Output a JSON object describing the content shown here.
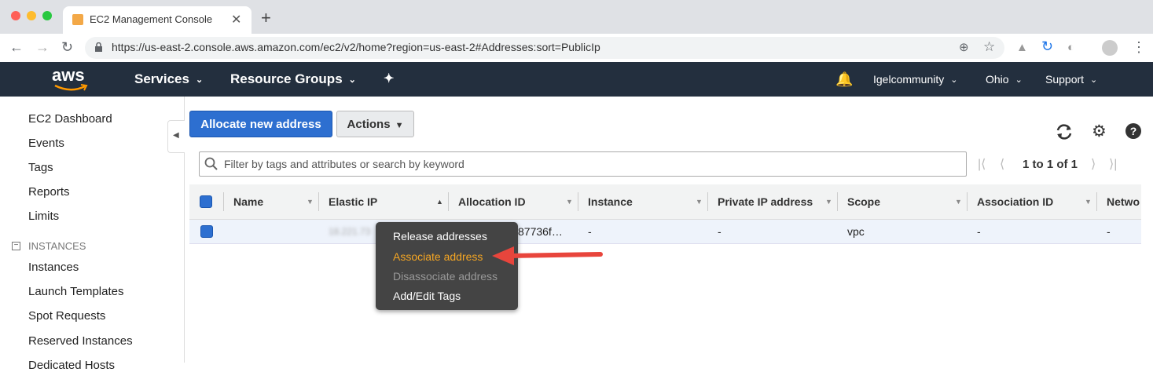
{
  "browser": {
    "tab_title": "EC2 Management Console",
    "new_tab_symbol": "+",
    "url": "https://us-east-2.console.aws.amazon.com/ec2/v2/home?region=us-east-2#Addresses:sort=PublicIp"
  },
  "aws_nav": {
    "logo": "aws",
    "services": "Services",
    "resource_groups": "Resource Groups",
    "account": "Igelcommunity",
    "region": "Ohio",
    "support": "Support"
  },
  "sidebar": {
    "items": [
      "EC2 Dashboard",
      "Events",
      "Tags",
      "Reports",
      "Limits"
    ],
    "section_instances": "INSTANCES",
    "instance_items": [
      "Instances",
      "Launch Templates",
      "Spot Requests",
      "Reserved Instances",
      "Dedicated Hosts"
    ]
  },
  "toolbar": {
    "allocate_label": "Allocate new address",
    "actions_label": "Actions"
  },
  "filter": {
    "placeholder": "Filter by tags and attributes or search by keyword",
    "pagination": "1 to 1 of 1"
  },
  "table": {
    "columns": [
      "Name",
      "Elastic IP",
      "Allocation ID",
      "Instance",
      "Private IP address",
      "Scope",
      "Association ID",
      "Netwo"
    ],
    "row": {
      "name": "",
      "elastic_ip": "18.221.73",
      "allocation_id": "87736f…",
      "instance": "-",
      "private_ip": "-",
      "scope": "vpc",
      "association_id": "-",
      "network": "-"
    }
  },
  "context_menu": {
    "items": [
      "Release addresses",
      "Associate address",
      "Disassociate address",
      "Add/Edit Tags"
    ]
  },
  "colors": {
    "aws_nav_bg": "#232f3e",
    "primary_button": "#2d6fd0",
    "highlight": "#f5a623",
    "arrow": "#e8453c"
  }
}
